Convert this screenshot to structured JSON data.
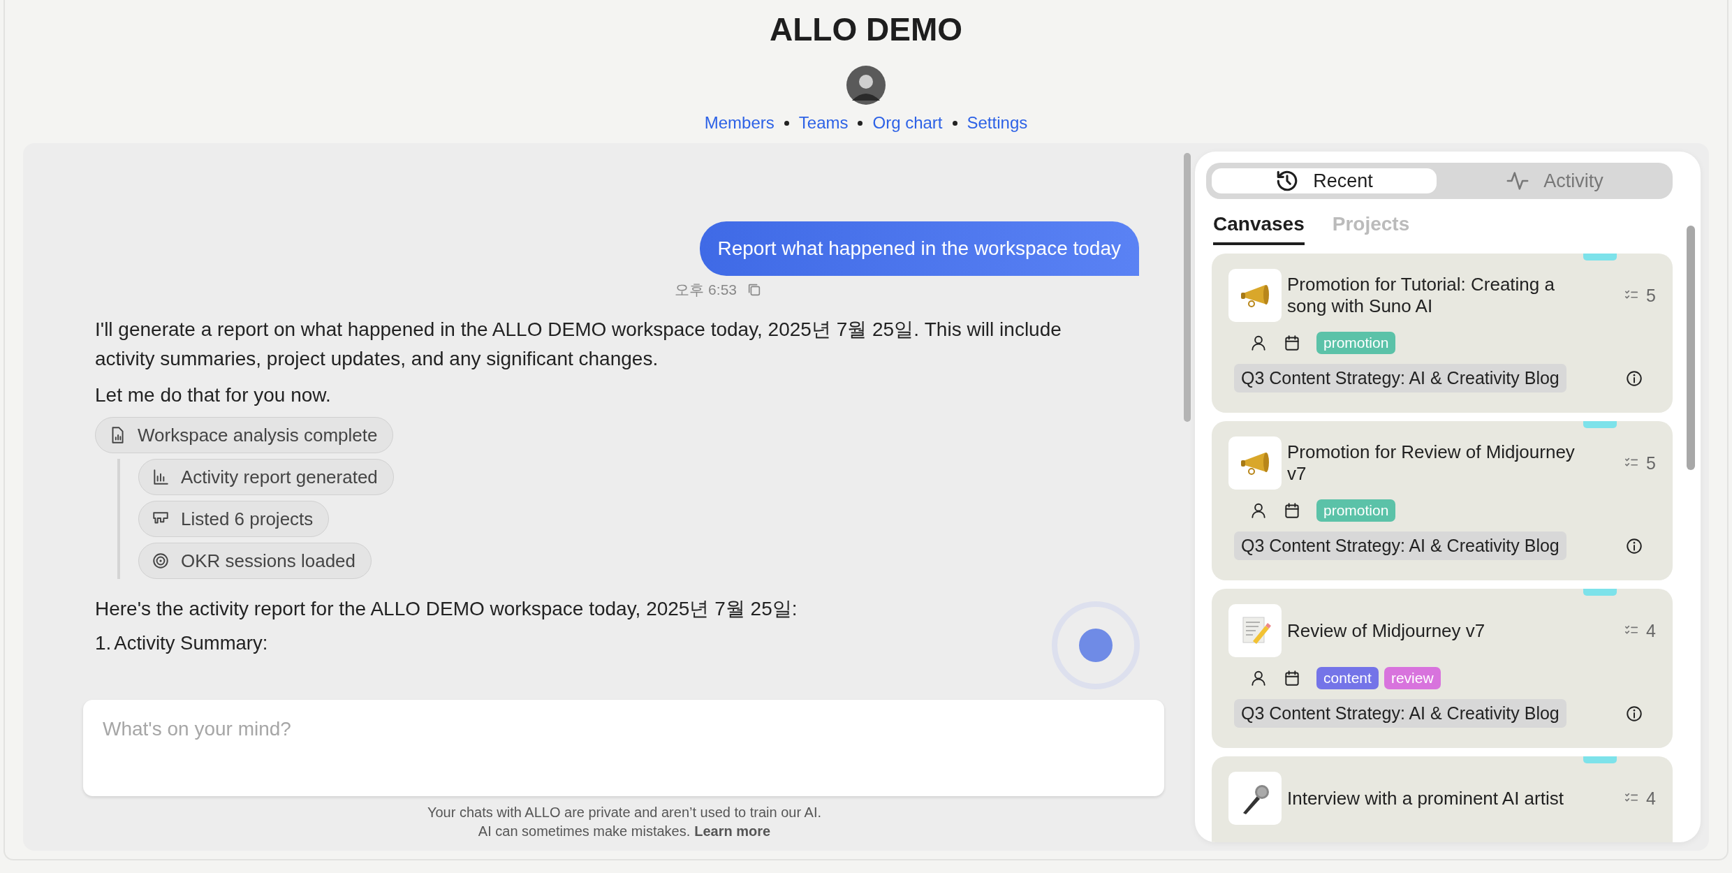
{
  "header": {
    "title": "ALLO DEMO",
    "nav": [
      {
        "label": "Members"
      },
      {
        "label": "Teams"
      },
      {
        "label": "Org chart"
      },
      {
        "label": "Settings"
      }
    ]
  },
  "chat": {
    "messages": [
      {
        "kind": "user",
        "text": "Report what happened in the workspace today",
        "time": "오후 6:53"
      },
      {
        "kind": "paragraph",
        "text": "I'll generate a report on what happened in the ALLO DEMO workspace today, 2025년 7월 25일. This will include activity summaries, project updates, and any significant changes."
      },
      {
        "kind": "paragraph",
        "text": "Let me do that for you now."
      },
      {
        "kind": "tool",
        "label": "Workspace analysis complete",
        "children": [
          {
            "label": "Activity report generated"
          },
          {
            "label": "Listed 6 projects"
          },
          {
            "label": "OKR sessions loaded"
          }
        ]
      },
      {
        "kind": "paragraph",
        "text": "Here's the activity report for the ALLO DEMO workspace today, 2025년 7월 25일:"
      },
      {
        "kind": "list_item",
        "number": "1.",
        "text": "Activity Summary:"
      }
    ],
    "input": {
      "placeholder": "What's on your mind?"
    },
    "disclaimer": {
      "line_1": "Your chats with ALLO are private and aren’t used to train our AI.",
      "line_2": "AI can sometimes make mistakes.",
      "link": "Learn more"
    }
  },
  "side_panel": {
    "view_tabs": [
      {
        "label": "Recent",
        "selected": true
      },
      {
        "label": "Activity",
        "selected": false
      }
    ],
    "sub_tabs": [
      {
        "label": "Canvases",
        "selected": true
      },
      {
        "label": "Projects",
        "selected": false
      }
    ],
    "cards": [
      {
        "title": "Promotion for Tutorial: Creating a song with Suno AI",
        "count": "5",
        "tags": [
          {
            "label": "promotion",
            "color": "#5bc2a8"
          }
        ],
        "project": "Q3 Content Strategy: AI & Creativity Blog"
      },
      {
        "title": "Promotion for Review of Midjourney v7",
        "count": "5",
        "tags": [
          {
            "label": "promotion",
            "color": "#5bc2a8"
          }
        ],
        "project": "Q3 Content Strategy: AI & Creativity Blog"
      },
      {
        "title": "Review of Midjourney v7",
        "count": "4",
        "tags": [
          {
            "label": "content",
            "color": "#7474e8"
          },
          {
            "label": "review",
            "color": "#d873dd"
          }
        ],
        "project": "Q3 Content Strategy: AI & Creativity Blog"
      },
      {
        "title": "Interview with a prominent AI artist",
        "count": "4"
      }
    ]
  }
}
